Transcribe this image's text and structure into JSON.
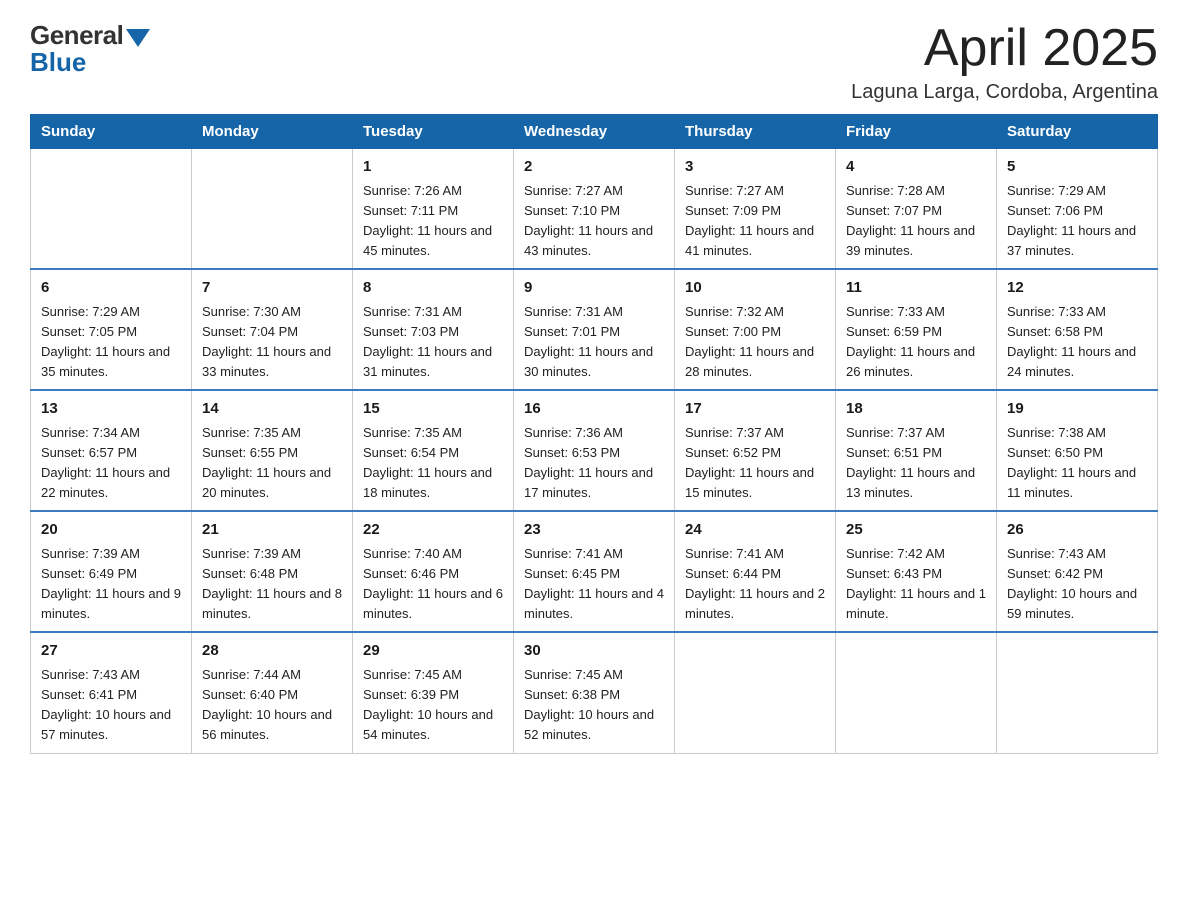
{
  "header": {
    "logo_general": "General",
    "logo_blue": "Blue",
    "month_title": "April 2025",
    "subtitle": "Laguna Larga, Cordoba, Argentina"
  },
  "weekdays": [
    "Sunday",
    "Monday",
    "Tuesday",
    "Wednesday",
    "Thursday",
    "Friday",
    "Saturday"
  ],
  "weeks": [
    [
      {
        "day": "",
        "sunrise": "",
        "sunset": "",
        "daylight": ""
      },
      {
        "day": "",
        "sunrise": "",
        "sunset": "",
        "daylight": ""
      },
      {
        "day": "1",
        "sunrise": "Sunrise: 7:26 AM",
        "sunset": "Sunset: 7:11 PM",
        "daylight": "Daylight: 11 hours and 45 minutes."
      },
      {
        "day": "2",
        "sunrise": "Sunrise: 7:27 AM",
        "sunset": "Sunset: 7:10 PM",
        "daylight": "Daylight: 11 hours and 43 minutes."
      },
      {
        "day": "3",
        "sunrise": "Sunrise: 7:27 AM",
        "sunset": "Sunset: 7:09 PM",
        "daylight": "Daylight: 11 hours and 41 minutes."
      },
      {
        "day": "4",
        "sunrise": "Sunrise: 7:28 AM",
        "sunset": "Sunset: 7:07 PM",
        "daylight": "Daylight: 11 hours and 39 minutes."
      },
      {
        "day": "5",
        "sunrise": "Sunrise: 7:29 AM",
        "sunset": "Sunset: 7:06 PM",
        "daylight": "Daylight: 11 hours and 37 minutes."
      }
    ],
    [
      {
        "day": "6",
        "sunrise": "Sunrise: 7:29 AM",
        "sunset": "Sunset: 7:05 PM",
        "daylight": "Daylight: 11 hours and 35 minutes."
      },
      {
        "day": "7",
        "sunrise": "Sunrise: 7:30 AM",
        "sunset": "Sunset: 7:04 PM",
        "daylight": "Daylight: 11 hours and 33 minutes."
      },
      {
        "day": "8",
        "sunrise": "Sunrise: 7:31 AM",
        "sunset": "Sunset: 7:03 PM",
        "daylight": "Daylight: 11 hours and 31 minutes."
      },
      {
        "day": "9",
        "sunrise": "Sunrise: 7:31 AM",
        "sunset": "Sunset: 7:01 PM",
        "daylight": "Daylight: 11 hours and 30 minutes."
      },
      {
        "day": "10",
        "sunrise": "Sunrise: 7:32 AM",
        "sunset": "Sunset: 7:00 PM",
        "daylight": "Daylight: 11 hours and 28 minutes."
      },
      {
        "day": "11",
        "sunrise": "Sunrise: 7:33 AM",
        "sunset": "Sunset: 6:59 PM",
        "daylight": "Daylight: 11 hours and 26 minutes."
      },
      {
        "day": "12",
        "sunrise": "Sunrise: 7:33 AM",
        "sunset": "Sunset: 6:58 PM",
        "daylight": "Daylight: 11 hours and 24 minutes."
      }
    ],
    [
      {
        "day": "13",
        "sunrise": "Sunrise: 7:34 AM",
        "sunset": "Sunset: 6:57 PM",
        "daylight": "Daylight: 11 hours and 22 minutes."
      },
      {
        "day": "14",
        "sunrise": "Sunrise: 7:35 AM",
        "sunset": "Sunset: 6:55 PM",
        "daylight": "Daylight: 11 hours and 20 minutes."
      },
      {
        "day": "15",
        "sunrise": "Sunrise: 7:35 AM",
        "sunset": "Sunset: 6:54 PM",
        "daylight": "Daylight: 11 hours and 18 minutes."
      },
      {
        "day": "16",
        "sunrise": "Sunrise: 7:36 AM",
        "sunset": "Sunset: 6:53 PM",
        "daylight": "Daylight: 11 hours and 17 minutes."
      },
      {
        "day": "17",
        "sunrise": "Sunrise: 7:37 AM",
        "sunset": "Sunset: 6:52 PM",
        "daylight": "Daylight: 11 hours and 15 minutes."
      },
      {
        "day": "18",
        "sunrise": "Sunrise: 7:37 AM",
        "sunset": "Sunset: 6:51 PM",
        "daylight": "Daylight: 11 hours and 13 minutes."
      },
      {
        "day": "19",
        "sunrise": "Sunrise: 7:38 AM",
        "sunset": "Sunset: 6:50 PM",
        "daylight": "Daylight: 11 hours and 11 minutes."
      }
    ],
    [
      {
        "day": "20",
        "sunrise": "Sunrise: 7:39 AM",
        "sunset": "Sunset: 6:49 PM",
        "daylight": "Daylight: 11 hours and 9 minutes."
      },
      {
        "day": "21",
        "sunrise": "Sunrise: 7:39 AM",
        "sunset": "Sunset: 6:48 PM",
        "daylight": "Daylight: 11 hours and 8 minutes."
      },
      {
        "day": "22",
        "sunrise": "Sunrise: 7:40 AM",
        "sunset": "Sunset: 6:46 PM",
        "daylight": "Daylight: 11 hours and 6 minutes."
      },
      {
        "day": "23",
        "sunrise": "Sunrise: 7:41 AM",
        "sunset": "Sunset: 6:45 PM",
        "daylight": "Daylight: 11 hours and 4 minutes."
      },
      {
        "day": "24",
        "sunrise": "Sunrise: 7:41 AM",
        "sunset": "Sunset: 6:44 PM",
        "daylight": "Daylight: 11 hours and 2 minutes."
      },
      {
        "day": "25",
        "sunrise": "Sunrise: 7:42 AM",
        "sunset": "Sunset: 6:43 PM",
        "daylight": "Daylight: 11 hours and 1 minute."
      },
      {
        "day": "26",
        "sunrise": "Sunrise: 7:43 AM",
        "sunset": "Sunset: 6:42 PM",
        "daylight": "Daylight: 10 hours and 59 minutes."
      }
    ],
    [
      {
        "day": "27",
        "sunrise": "Sunrise: 7:43 AM",
        "sunset": "Sunset: 6:41 PM",
        "daylight": "Daylight: 10 hours and 57 minutes."
      },
      {
        "day": "28",
        "sunrise": "Sunrise: 7:44 AM",
        "sunset": "Sunset: 6:40 PM",
        "daylight": "Daylight: 10 hours and 56 minutes."
      },
      {
        "day": "29",
        "sunrise": "Sunrise: 7:45 AM",
        "sunset": "Sunset: 6:39 PM",
        "daylight": "Daylight: 10 hours and 54 minutes."
      },
      {
        "day": "30",
        "sunrise": "Sunrise: 7:45 AM",
        "sunset": "Sunset: 6:38 PM",
        "daylight": "Daylight: 10 hours and 52 minutes."
      },
      {
        "day": "",
        "sunrise": "",
        "sunset": "",
        "daylight": ""
      },
      {
        "day": "",
        "sunrise": "",
        "sunset": "",
        "daylight": ""
      },
      {
        "day": "",
        "sunrise": "",
        "sunset": "",
        "daylight": ""
      }
    ]
  ]
}
